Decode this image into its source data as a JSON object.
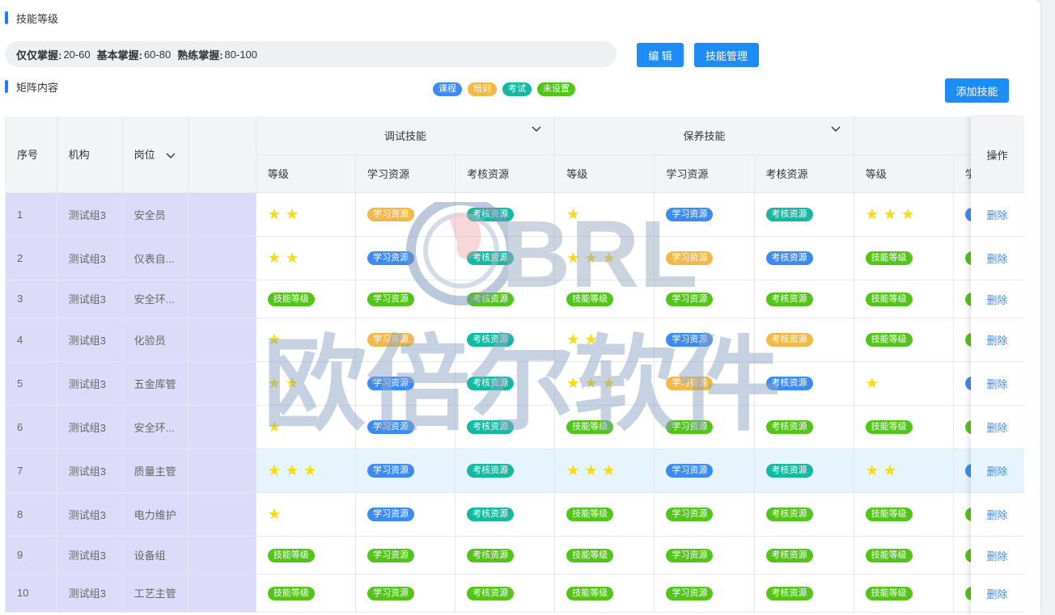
{
  "section1": {
    "title": "技能等级"
  },
  "ranges": [
    {
      "label": "仅仅掌握:",
      "value": "20-60"
    },
    {
      "label": "基本掌握:",
      "value": "60-80"
    },
    {
      "label": "熟练掌握:",
      "value": "80-100"
    }
  ],
  "buttons": {
    "edit": "编 辑",
    "skill_manage": "技能管理",
    "add_skill": "添加技能"
  },
  "section2": {
    "title": "矩阵内容"
  },
  "legend": [
    {
      "label": "课程",
      "color": "#3c8cf0"
    },
    {
      "label": "培训",
      "color": "#f2b94a"
    },
    {
      "label": "考试",
      "color": "#17b8a2"
    },
    {
      "label": "未设置",
      "color": "#52c41a"
    }
  ],
  "table": {
    "headers": {
      "index": "序号",
      "org": "机构",
      "post": "岗位",
      "ops": "操作"
    },
    "groups": [
      "调试技能",
      "保养技能"
    ],
    "sub_headers": [
      "等级",
      "学习资源",
      "考核资源",
      "等级",
      "学习资源",
      "考核资源",
      "等级",
      "学"
    ],
    "labels": {
      "skill_level": "技能等级",
      "study": "学习资源",
      "assess": "考核资源",
      "delete": "删除"
    },
    "rows": [
      {
        "index": "1",
        "org": "测试组3",
        "post": "安全员",
        "cells": [
          {
            "stars": 2
          },
          {
            "tag": "study",
            "c": "train"
          },
          {
            "tag": "assess",
            "c": "exam"
          },
          {
            "stars": 1
          },
          {
            "tag": "study",
            "c": "course"
          },
          {
            "tag": "assess",
            "c": "exam"
          },
          {
            "stars": 3
          },
          {
            "tag": "study",
            "c": "course"
          }
        ]
      },
      {
        "index": "2",
        "org": "测试组3",
        "post": "仪表自...",
        "cells": [
          {
            "stars": 2
          },
          {
            "tag": "study",
            "c": "course"
          },
          {
            "tag": "assess",
            "c": "exam"
          },
          {
            "stars": 3
          },
          {
            "tag": "study",
            "c": "train"
          },
          {
            "tag": "assess",
            "c": "course"
          },
          {
            "tag": "skill_level",
            "c": "unset"
          },
          {
            "tag": "study",
            "c": "unset"
          }
        ]
      },
      {
        "index": "3",
        "org": "测试组3",
        "post": "安全环...",
        "cells": [
          {
            "tag": "skill_level",
            "c": "unset"
          },
          {
            "tag": "study",
            "c": "unset"
          },
          {
            "tag": "assess",
            "c": "unset"
          },
          {
            "tag": "skill_level",
            "c": "unset"
          },
          {
            "tag": "study",
            "c": "unset"
          },
          {
            "tag": "assess",
            "c": "unset"
          },
          {
            "tag": "skill_level",
            "c": "unset"
          },
          {
            "tag": "study",
            "c": "unset"
          }
        ]
      },
      {
        "index": "4",
        "org": "测试组3",
        "post": "化验员",
        "cells": [
          {
            "stars": 1
          },
          {
            "tag": "study",
            "c": "train"
          },
          {
            "tag": "assess",
            "c": "exam"
          },
          {
            "stars": 2
          },
          {
            "tag": "study",
            "c": "course"
          },
          {
            "tag": "assess",
            "c": "train"
          },
          {
            "tag": "skill_level",
            "c": "unset"
          },
          {
            "tag": "study",
            "c": "unset"
          }
        ]
      },
      {
        "index": "5",
        "org": "测试组3",
        "post": "五金库管",
        "cells": [
          {
            "stars": 2
          },
          {
            "tag": "study",
            "c": "course"
          },
          {
            "tag": "assess",
            "c": "exam"
          },
          {
            "stars": 3
          },
          {
            "tag": "study",
            "c": "train"
          },
          {
            "tag": "assess",
            "c": "course"
          },
          {
            "stars": 1
          },
          {
            "tag": "study",
            "c": "course"
          }
        ]
      },
      {
        "index": "6",
        "org": "测试组3",
        "post": "安全环...",
        "cells": [
          {
            "stars": 1
          },
          {
            "tag": "study",
            "c": "course"
          },
          {
            "tag": "assess",
            "c": "exam"
          },
          {
            "tag": "skill_level",
            "c": "unset"
          },
          {
            "tag": "study",
            "c": "unset"
          },
          {
            "tag": "assess",
            "c": "unset"
          },
          {
            "tag": "skill_level",
            "c": "unset"
          },
          {
            "tag": "study",
            "c": "unset"
          }
        ]
      },
      {
        "index": "7",
        "org": "测试组3",
        "post": "质量主管",
        "hl": true,
        "cells": [
          {
            "stars": 3
          },
          {
            "tag": "study",
            "c": "course"
          },
          {
            "tag": "assess",
            "c": "exam"
          },
          {
            "stars": 3
          },
          {
            "tag": "study",
            "c": "course"
          },
          {
            "tag": "assess",
            "c": "exam"
          },
          {
            "stars": 2
          },
          {
            "tag": "study",
            "c": "course"
          }
        ]
      },
      {
        "index": "8",
        "org": "测试组3",
        "post": "电力维护",
        "cells": [
          {
            "stars": 1
          },
          {
            "tag": "study",
            "c": "course"
          },
          {
            "tag": "assess",
            "c": "exam"
          },
          {
            "tag": "skill_level",
            "c": "unset"
          },
          {
            "tag": "study",
            "c": "unset"
          },
          {
            "tag": "assess",
            "c": "unset"
          },
          {
            "tag": "skill_level",
            "c": "unset"
          },
          {
            "tag": "study",
            "c": "unset"
          }
        ]
      },
      {
        "index": "9",
        "org": "测试组3",
        "post": "设备组",
        "cells": [
          {
            "tag": "skill_level",
            "c": "unset"
          },
          {
            "tag": "study",
            "c": "unset"
          },
          {
            "tag": "assess",
            "c": "unset"
          },
          {
            "tag": "skill_level",
            "c": "unset"
          },
          {
            "tag": "study",
            "c": "unset"
          },
          {
            "tag": "assess",
            "c": "unset"
          },
          {
            "tag": "skill_level",
            "c": "unset"
          },
          {
            "tag": "study",
            "c": "unset"
          }
        ]
      },
      {
        "index": "10",
        "org": "测试组3",
        "post": "工艺主管",
        "cells": [
          {
            "tag": "skill_level",
            "c": "unset"
          },
          {
            "tag": "study",
            "c": "unset"
          },
          {
            "tag": "assess",
            "c": "unset"
          },
          {
            "tag": "skill_level",
            "c": "unset"
          },
          {
            "tag": "study",
            "c": "unset"
          },
          {
            "tag": "assess",
            "c": "unset"
          },
          {
            "tag": "skill_level",
            "c": "unset"
          },
          {
            "tag": "study",
            "c": "unset"
          }
        ]
      }
    ]
  },
  "watermark": {
    "logo_text": "BRL",
    "text": "欧倍尔软件"
  }
}
